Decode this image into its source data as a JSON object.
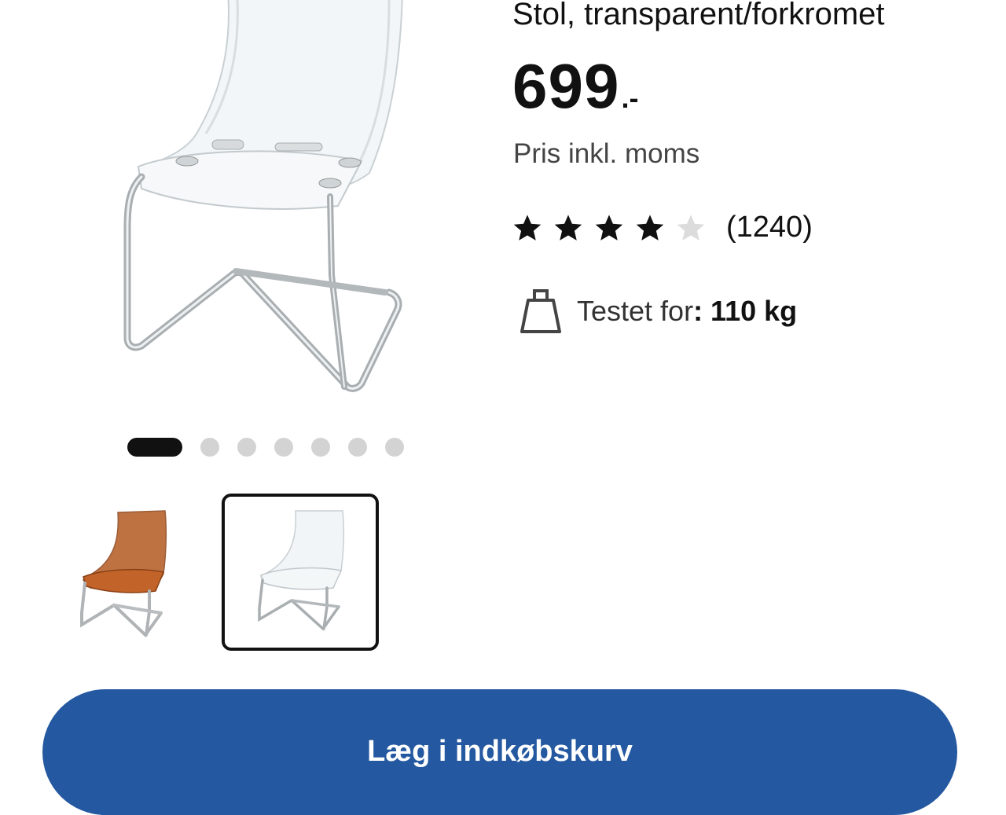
{
  "product": {
    "subtitle": "Stol, transparent/forkromet",
    "price": "699",
    "price_suffix": ".-",
    "vat_note": "Pris inkl. moms",
    "rating": {
      "value": 4,
      "max": 5,
      "review_count": "(1240)"
    },
    "tested": {
      "label": "Testet for",
      "value": ": 110 kg",
      "icon": "weight-icon"
    }
  },
  "gallery": {
    "total_images": 7,
    "active_index": 0,
    "thumbnails": [
      {
        "color": "#b35a22",
        "selected": false
      },
      {
        "color": "#e8eef2",
        "selected": true
      }
    ]
  },
  "actions": {
    "add_to_cart": "Læg i indkøbskurv"
  },
  "colors": {
    "accent": "#2458a0",
    "star": "#111111",
    "star_empty": "#dcdcdc"
  }
}
